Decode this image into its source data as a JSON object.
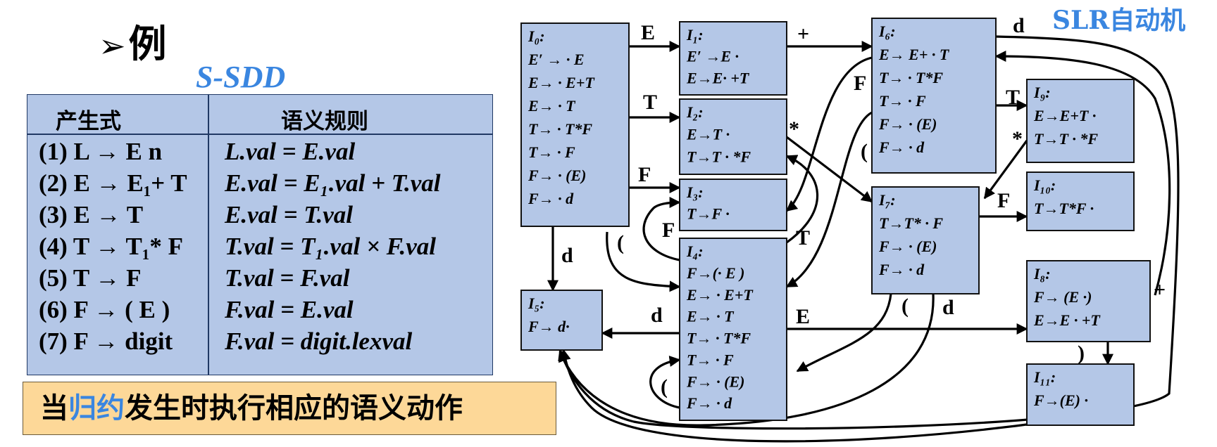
{
  "heading": {
    "pointer": "➢",
    "text": "例"
  },
  "sdd": {
    "title": "S-SDD",
    "col_production": "产生式",
    "col_rule": "语义规则",
    "rows": [
      {
        "production": "(1) L → E n",
        "rule": "L.val = E.val"
      },
      {
        "production": "(2) E → E₁+ T",
        "rule": "E.val = E₁.val + T.val"
      },
      {
        "production": "(3) E → T",
        "rule": "E.val = T.val"
      },
      {
        "production": "(4) T → T₁* F",
        "rule": "T.val = T₁.val × F.val"
      },
      {
        "production": "(5) T → F",
        "rule": "T.val = F.val"
      },
      {
        "production": "(6) F → ( E )",
        "rule": "F.val = E.val"
      },
      {
        "production": "(7) F → digit",
        "rule": "F.val = digit.lexval"
      }
    ]
  },
  "note": {
    "part1": "当",
    "part2": "归约",
    "part3": "发生时执行相应的语义动作"
  },
  "automaton": {
    "title": "SLR自动机",
    "states": [
      {
        "id": "I0",
        "lines": [
          "I₀:",
          "E′ → · E",
          "E→ · E+T",
          "E→ · T",
          "T→ · T*F",
          "T→ · F",
          "F→ · (E)",
          "F→ · d"
        ]
      },
      {
        "id": "I1",
        "lines": [
          "I₁:",
          "E′ →E ·",
          "E→E· +T"
        ]
      },
      {
        "id": "I2",
        "lines": [
          "I₂:",
          "E→T ·",
          "T→T · *F"
        ]
      },
      {
        "id": "I3",
        "lines": [
          "I₃:",
          "T→F ·"
        ]
      },
      {
        "id": "I4",
        "lines": [
          "I₄:",
          "F→(· E )",
          "E→ · E+T",
          "E→ · T",
          "T→ · T*F",
          "T→ · F",
          "F→ · (E)",
          "F→ · d"
        ]
      },
      {
        "id": "I5",
        "lines": [
          "I₅:",
          "F→ d·"
        ]
      },
      {
        "id": "I6",
        "lines": [
          "I₆:",
          "E→ E+ · T",
          "T→ · T*F",
          "T→ · F",
          "F→ · (E)",
          "F→ · d"
        ]
      },
      {
        "id": "I7",
        "lines": [
          "I₇:",
          "T→T* · F",
          "F→ · (E)",
          "F→ · d"
        ]
      },
      {
        "id": "I8",
        "lines": [
          "I₈:",
          "F→ (E ·)",
          "E→E · +T"
        ]
      },
      {
        "id": "I9",
        "lines": [
          "I₉:",
          "E→E+T ·",
          "T→T · *F"
        ]
      },
      {
        "id": "I10",
        "lines": [
          "I₁₀:",
          "T→T*F ·"
        ]
      },
      {
        "id": "I11",
        "lines": [
          "I₁₁:",
          "F→(E) ·"
        ]
      }
    ],
    "edge_labels": {
      "e0_1": "E",
      "e0_2": "T",
      "e0_3": "F",
      "e0_5": "d",
      "e0_4": "(",
      "e1_6": "+",
      "e2_7": "*",
      "e6_9": "T",
      "e6_3": "F",
      "e6_4": "(",
      "e6_5": "d",
      "e9_7": "*",
      "e7_10": "F",
      "e7_4": "(",
      "e7_5": "d",
      "e4_5": "d",
      "e4_8": "E",
      "e4_3": "F",
      "e4_2": "T",
      "e4_4": "(",
      "e8_6": "+",
      "e8_11": ")"
    }
  }
}
